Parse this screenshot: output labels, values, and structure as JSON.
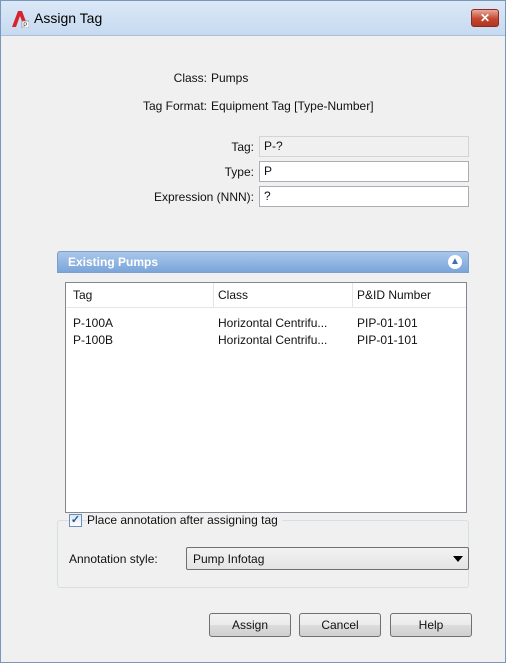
{
  "window": {
    "title": "Assign Tag",
    "close_label": "✕"
  },
  "info": {
    "class_label": "Class:",
    "class_value": "Pumps",
    "format_label": "Tag Format:",
    "format_value": "Equipment Tag [Type-Number]"
  },
  "form": {
    "tag_label": "Tag:",
    "tag_value": "P-?",
    "type_label": "Type:",
    "type_value": "P",
    "expr_label": "Expression (NNN):",
    "expr_value": "?"
  },
  "existing": {
    "header": "Existing Pumps",
    "columns": [
      "Tag",
      "Class",
      "P&ID Number"
    ],
    "rows": [
      [
        "P-100A",
        "Horizontal Centrifu...",
        "PIP-01-101"
      ],
      [
        "P-100B",
        "Horizontal Centrifu...",
        "PIP-01-101"
      ]
    ]
  },
  "annotation": {
    "checkbox_label": "Place annotation after assigning tag",
    "checked": true,
    "style_label": "Annotation style:",
    "style_value": "Pump Infotag"
  },
  "buttons": {
    "assign": "Assign",
    "cancel": "Cancel",
    "help": "Help"
  },
  "colors": {
    "title_bar": "#c7daf0",
    "section_header": "#7ba5da",
    "close": "#c4472f"
  }
}
